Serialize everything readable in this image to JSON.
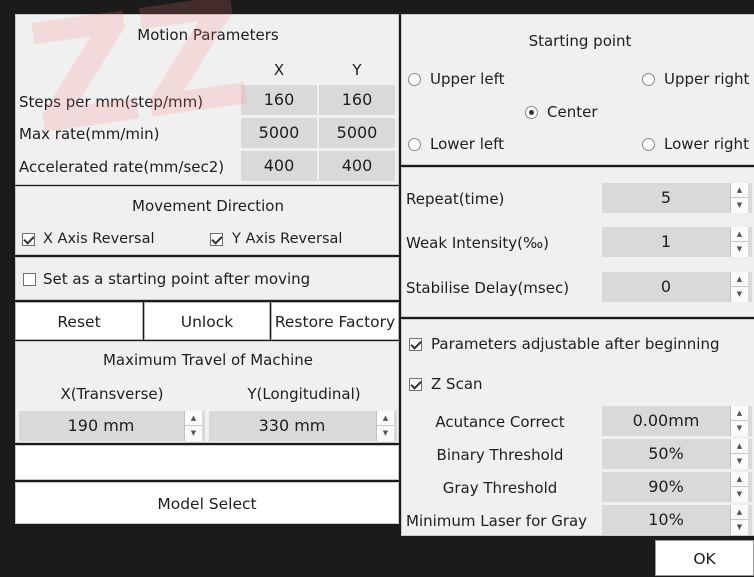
{
  "motion": {
    "title": "Motion Parameters",
    "col_x": "X",
    "col_y": "Y",
    "rows": [
      {
        "label": "Steps per mm(step/mm)",
        "x": "160",
        "y": "160"
      },
      {
        "label": "Max rate(mm/min)",
        "x": "5000",
        "y": "5000"
      },
      {
        "label": "Accelerated rate(mm/sec2)",
        "x": "400",
        "y": "400"
      }
    ]
  },
  "movement": {
    "title": "Movement Direction",
    "x_reversal": {
      "label": "X Axis Reversal",
      "checked": true
    },
    "y_reversal": {
      "label": "Y Axis Reversal",
      "checked": true
    }
  },
  "set_start": {
    "label": "Set as a starting point after moving",
    "checked": false
  },
  "buttons": {
    "reset": "Reset",
    "unlock": "Unlock",
    "restore": "Restore Factory",
    "model_select": "Model Select",
    "ok": "OK"
  },
  "travel": {
    "title": "Maximum Travel of Machine",
    "x_label": "X(Transverse)",
    "y_label": "Y(Longitudinal)",
    "x_value": "190 mm",
    "y_value": "330 mm"
  },
  "starting_point": {
    "title": "Starting point",
    "options": {
      "upper_left": "Upper left",
      "upper_right": "Upper right",
      "center": "Center",
      "lower_left": "Lower left",
      "lower_right": "Lower right"
    },
    "selected": "center"
  },
  "repeat": {
    "repeat_label": "Repeat(time)",
    "repeat_value": "5",
    "weak_label": "Weak Intensity(‰)",
    "weak_value": "1",
    "delay_label": "Stabilise Delay(msec)",
    "delay_value": "0"
  },
  "advanced": {
    "adjustable": {
      "label": "Parameters adjustable after beginning",
      "checked": true
    },
    "zscan": {
      "label": "Z Scan",
      "checked": true
    },
    "acutance_label": "Acutance Correct",
    "acutance_value": "0.00mm",
    "binary_label": "Binary Threshold",
    "binary_value": "50%",
    "gray_label": "Gray Threshold",
    "gray_value": "90%",
    "minlaser_label": "Minimum Laser for Gray",
    "minlaser_value": "10%"
  },
  "colors": {
    "panel": "#f0f0f0",
    "cell": "#d9d9d9",
    "background": "#1b1b1b",
    "watermark": "#ff7878"
  }
}
